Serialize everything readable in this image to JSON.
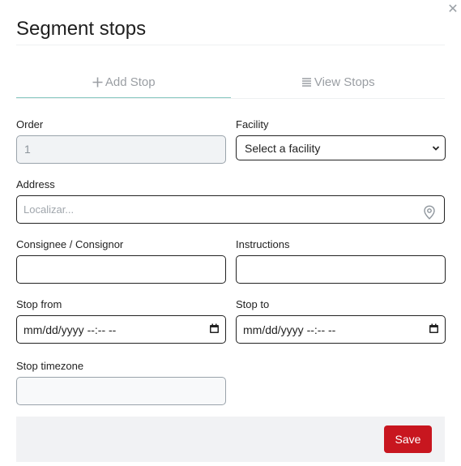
{
  "modal": {
    "title": "Segment stops",
    "close_icon": "close-icon"
  },
  "tabs": [
    {
      "label": "Add Stop",
      "icon": "plus-icon",
      "active": true
    },
    {
      "label": "View Stops",
      "icon": "list-icon",
      "active": false
    }
  ],
  "form": {
    "order": {
      "label": "Order",
      "value": "1"
    },
    "facility": {
      "label": "Facility",
      "selected": "Select a facility"
    },
    "address": {
      "label": "Address",
      "placeholder": "Localizar...",
      "icon": "location-pin-icon"
    },
    "consignee": {
      "label": "Consignee / Consignor",
      "value": ""
    },
    "instructions": {
      "label": "Instructions",
      "value": ""
    },
    "stop_from": {
      "label": "Stop from",
      "value": "mm/dd/yyyy --:-- --",
      "icon": "calendar-icon"
    },
    "stop_to": {
      "label": "Stop to",
      "value": "mm/dd/yyyy --:-- --",
      "icon": "calendar-icon"
    },
    "stop_timezone": {
      "label": "Stop timezone",
      "value": ""
    }
  },
  "footer": {
    "save_label": "Save",
    "save_color": "#c8161f"
  }
}
